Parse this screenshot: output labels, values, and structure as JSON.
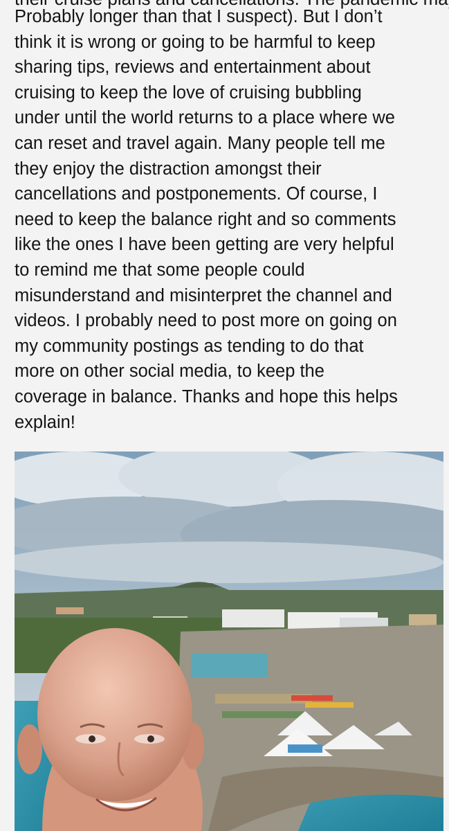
{
  "post": {
    "cut_off_line": "their cruise plans and cancellations. The pandemic may",
    "body": "Probably longer than that I suspect). But I don’t\nthink it is wrong or going to be harmful to keep\nsharing tips, reviews and entertainment about\ncruising to keep the love of cruising bubbling\nunder until the world returns to a place where we\ncan reset and travel again. Many people tell me\nthey enjoy the distraction amongst their\ncancellations and postponements. Of course, I\nneed to keep the balance right and so comments\nlike the ones I have been getting are very helpful\nto remind me that some people could\nmisunderstand and misinterpret the channel and\nvideos. I probably need to post more on going on\nmy community postings as tending to do that\nmore on other social media, to keep the\ncoverage in balance. Thanks and hope this helps\nexplain!"
  },
  "photo": {
    "description_icon": "selfie-photo"
  },
  "colors": {
    "background": "#f3f3f3",
    "text": "#141414"
  }
}
